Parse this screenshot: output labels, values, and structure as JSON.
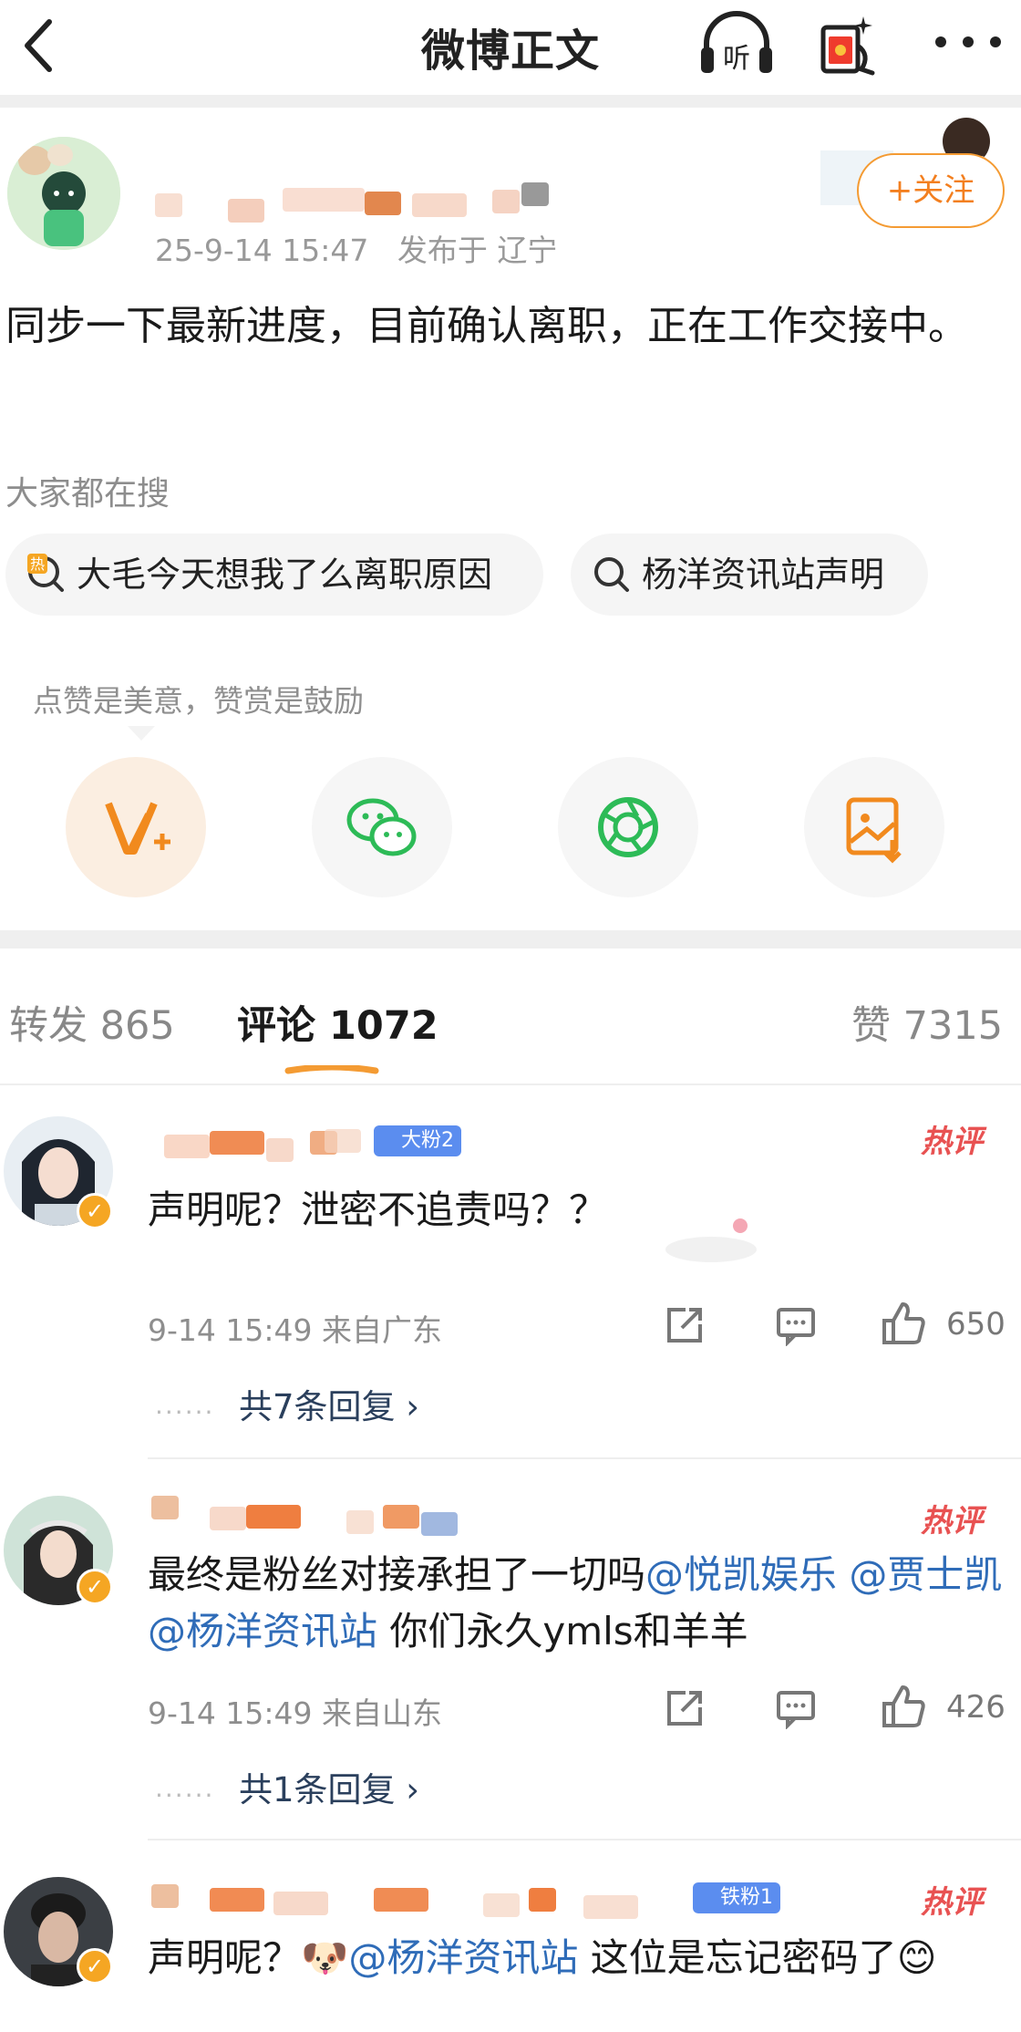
{
  "header": {
    "title": "微博正文",
    "listen_label": "听"
  },
  "post": {
    "time": "25-9-14 15:47",
    "location": "发布于 辽宁",
    "text": "同步一下最新进度，目前确认离职，正在工作交接中。",
    "follow_label": "+关注"
  },
  "search": {
    "title": "大家都在搜",
    "hot_icon_label": "热",
    "items": [
      "大毛今天想我了么离职原因",
      "杨洋资讯站声明"
    ]
  },
  "praise": {
    "tip": "点赞是美意，赞赏是鼓励",
    "buttons": [
      "v-plus-icon",
      "wechat-icon",
      "moments-icon",
      "save-image-icon"
    ]
  },
  "tabs": {
    "repost_label": "转发",
    "repost_count": "865",
    "comment_label": "评论",
    "comment_count": "1072",
    "like_label": "赞",
    "like_count": "7315"
  },
  "comments": [
    {
      "badge": "大粉2",
      "hot": "热评",
      "text_parts": [
        {
          "t": "声明呢？泄密不追责吗？？",
          "m": false
        }
      ],
      "time": "9-14 15:49",
      "location": "来自广东",
      "likes": "650",
      "replies": "共7条回复 ›"
    },
    {
      "badge": "",
      "hot": "热评",
      "text_parts": [
        {
          "t": "最终是粉丝对接承担了一切吗",
          "m": false
        },
        {
          "t": "@悦凯娱乐",
          "m": true
        },
        {
          "t": " ",
          "m": false
        },
        {
          "t": "@贾士凯",
          "m": true
        },
        {
          "t": " ",
          "m": false
        },
        {
          "t": "@杨洋资讯站",
          "m": true
        },
        {
          "t": " 你们永久ymls和羊羊",
          "m": false
        }
      ],
      "time": "9-14 15:49",
      "location": "来自山东",
      "likes": "426",
      "replies": "共1条回复 ›"
    },
    {
      "badge": "铁粉1",
      "hot": "热评",
      "text_parts": [
        {
          "t": "声明呢？",
          "m": false
        },
        {
          "t": "🐶",
          "m": false
        },
        {
          "t": "@杨洋资讯站",
          "m": true
        },
        {
          "t": " 这位是忘记密码了",
          "m": false
        },
        {
          "t": "😊",
          "m": false
        }
      ],
      "time": "",
      "location": "",
      "likes": "",
      "replies": ""
    }
  ],
  "colors": {
    "accent_orange": "#f37f1f",
    "mention_blue": "#2f6cb8",
    "hot_red": "#e85252",
    "wechat_green": "#2dbb57"
  }
}
